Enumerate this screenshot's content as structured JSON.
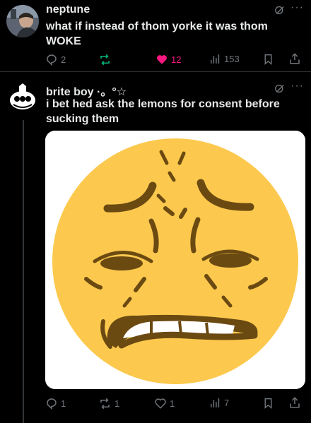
{
  "post1": {
    "username": "neptune",
    "text": "what if instead of thom yorke it was thom WOKE",
    "replies": "2",
    "reposts": "",
    "likes": "12",
    "views": "153",
    "like_color": "#f91880",
    "repost_color": "#00ba7c"
  },
  "post2": {
    "username": "brite boy ·。°☆",
    "text": "i bet hed ask the lemons for consent before sucking them",
    "replies": "1",
    "reposts": "1",
    "likes": "1",
    "views": "7",
    "image_alt": "yellow face emoji with grimacing expression"
  },
  "icons": [
    "grok-icon",
    "more-icon",
    "reply-icon",
    "repost-icon",
    "like-icon",
    "views-icon",
    "bookmark-icon",
    "share-icon"
  ]
}
